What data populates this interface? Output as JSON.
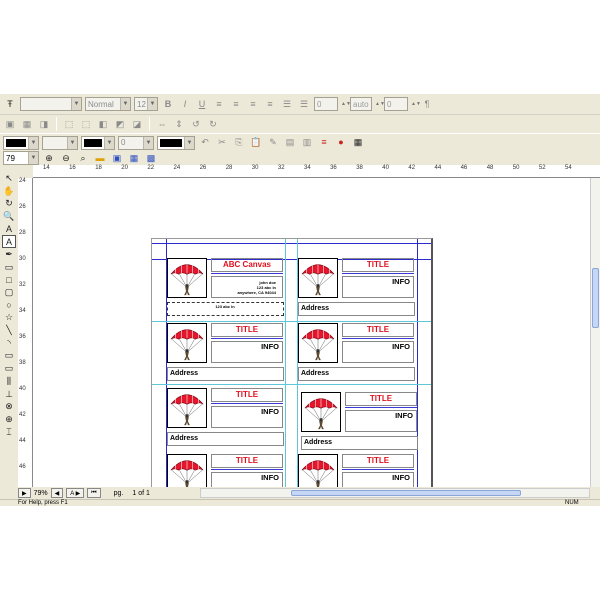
{
  "toolbar": {
    "font_style": "Normal",
    "font_size": "12",
    "spacing_value": "0",
    "line_spacing": "auto",
    "indent_value": "0",
    "line_width": "0",
    "zoom_field": "79",
    "icons": [
      "text-tool-icon",
      "bold-icon",
      "italic-icon",
      "underline-icon",
      "align-left-icon",
      "align-center-icon",
      "align-right-icon",
      "justify-icon",
      "paragraph-icon",
      "cut-icon",
      "copy-icon",
      "paste-icon",
      "undo-icon",
      "zoom-in-icon",
      "zoom-out-icon"
    ]
  },
  "rulers": {
    "horizontal": [
      "14",
      "16",
      "18",
      "20",
      "22",
      "24",
      "26",
      "28",
      "30",
      "32",
      "34",
      "36",
      "38",
      "40",
      "42",
      "44",
      "46",
      "48",
      "50",
      "52",
      "54"
    ],
    "vertical": [
      "24",
      "26",
      "28",
      "30",
      "32",
      "34",
      "36",
      "38",
      "40",
      "42",
      "44",
      "46"
    ]
  },
  "cards": [
    {
      "title": "ABC Canvas",
      "info": "",
      "address_lines": [
        "john doe",
        "123 abc ln",
        "anywhere, CA 94044"
      ],
      "address": "",
      "footer_text": "123 abc ln"
    },
    {
      "title": "TITLE",
      "info": "INFO",
      "address": "Address"
    },
    {
      "title": "TITLE",
      "info": "INFO",
      "address": "Address"
    },
    {
      "title": "TITLE",
      "info": "INFO",
      "address": "Address"
    },
    {
      "title": "TITLE",
      "info": "INFO",
      "address": "Address"
    },
    {
      "title": "TITLE",
      "info": "INFO",
      "address": "Address"
    },
    {
      "title": "TITLE",
      "info": "INFO",
      "address": ""
    },
    {
      "title": "TITLE",
      "info": "INFO",
      "address": ""
    }
  ],
  "navigation": {
    "zoom": "79%",
    "page_label": "pg.",
    "page_indicator": "1 of 1"
  },
  "status": {
    "help": "For Help, press F1",
    "num": "NUM"
  },
  "colors": {
    "title_red": "#e0101e",
    "guide_cyan": "#5ec8d8",
    "margin_blue": "#2b2bd0"
  }
}
